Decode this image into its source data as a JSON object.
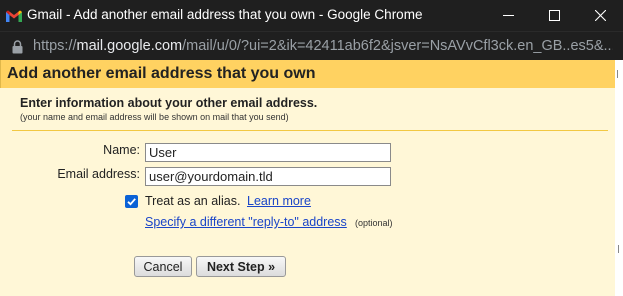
{
  "window": {
    "title": "Gmail - Add another email address that you own - Google Chrome",
    "minimize_icon": "minimize-icon",
    "maximize_icon": "maximize-icon",
    "close_icon": "close-icon"
  },
  "addressbar": {
    "scheme": "https://",
    "host": "mail.google.com",
    "path": "/mail/u/0/?ui=2&ik=42411ab6f2&jsver=NsAVvCfl3ck.en_GB..es5&..."
  },
  "dialog": {
    "title": "Add another email address that you own",
    "heading": "Enter information about your other email address.",
    "subtext": "(your name and email address will be shown on mail that you send)",
    "name_label": "Name:",
    "name_value": "User",
    "email_label": "Email address:",
    "email_value": "user@yourdomain.tld",
    "alias_label": "Treat as an alias.",
    "alias_checked": true,
    "learn_more": "Learn more",
    "reply_to_link": "Specify a different \"reply-to\" address",
    "optional": "(optional)",
    "cancel_button": "Cancel",
    "next_button": "Next Step »"
  },
  "colors": {
    "titlebar_bg": "#1f1f1f",
    "dialog_header_bg": "#ffd261",
    "dialog_body_bg": "#fff7d7",
    "link": "#1a45c8",
    "checkbox": "#0b62d6"
  }
}
